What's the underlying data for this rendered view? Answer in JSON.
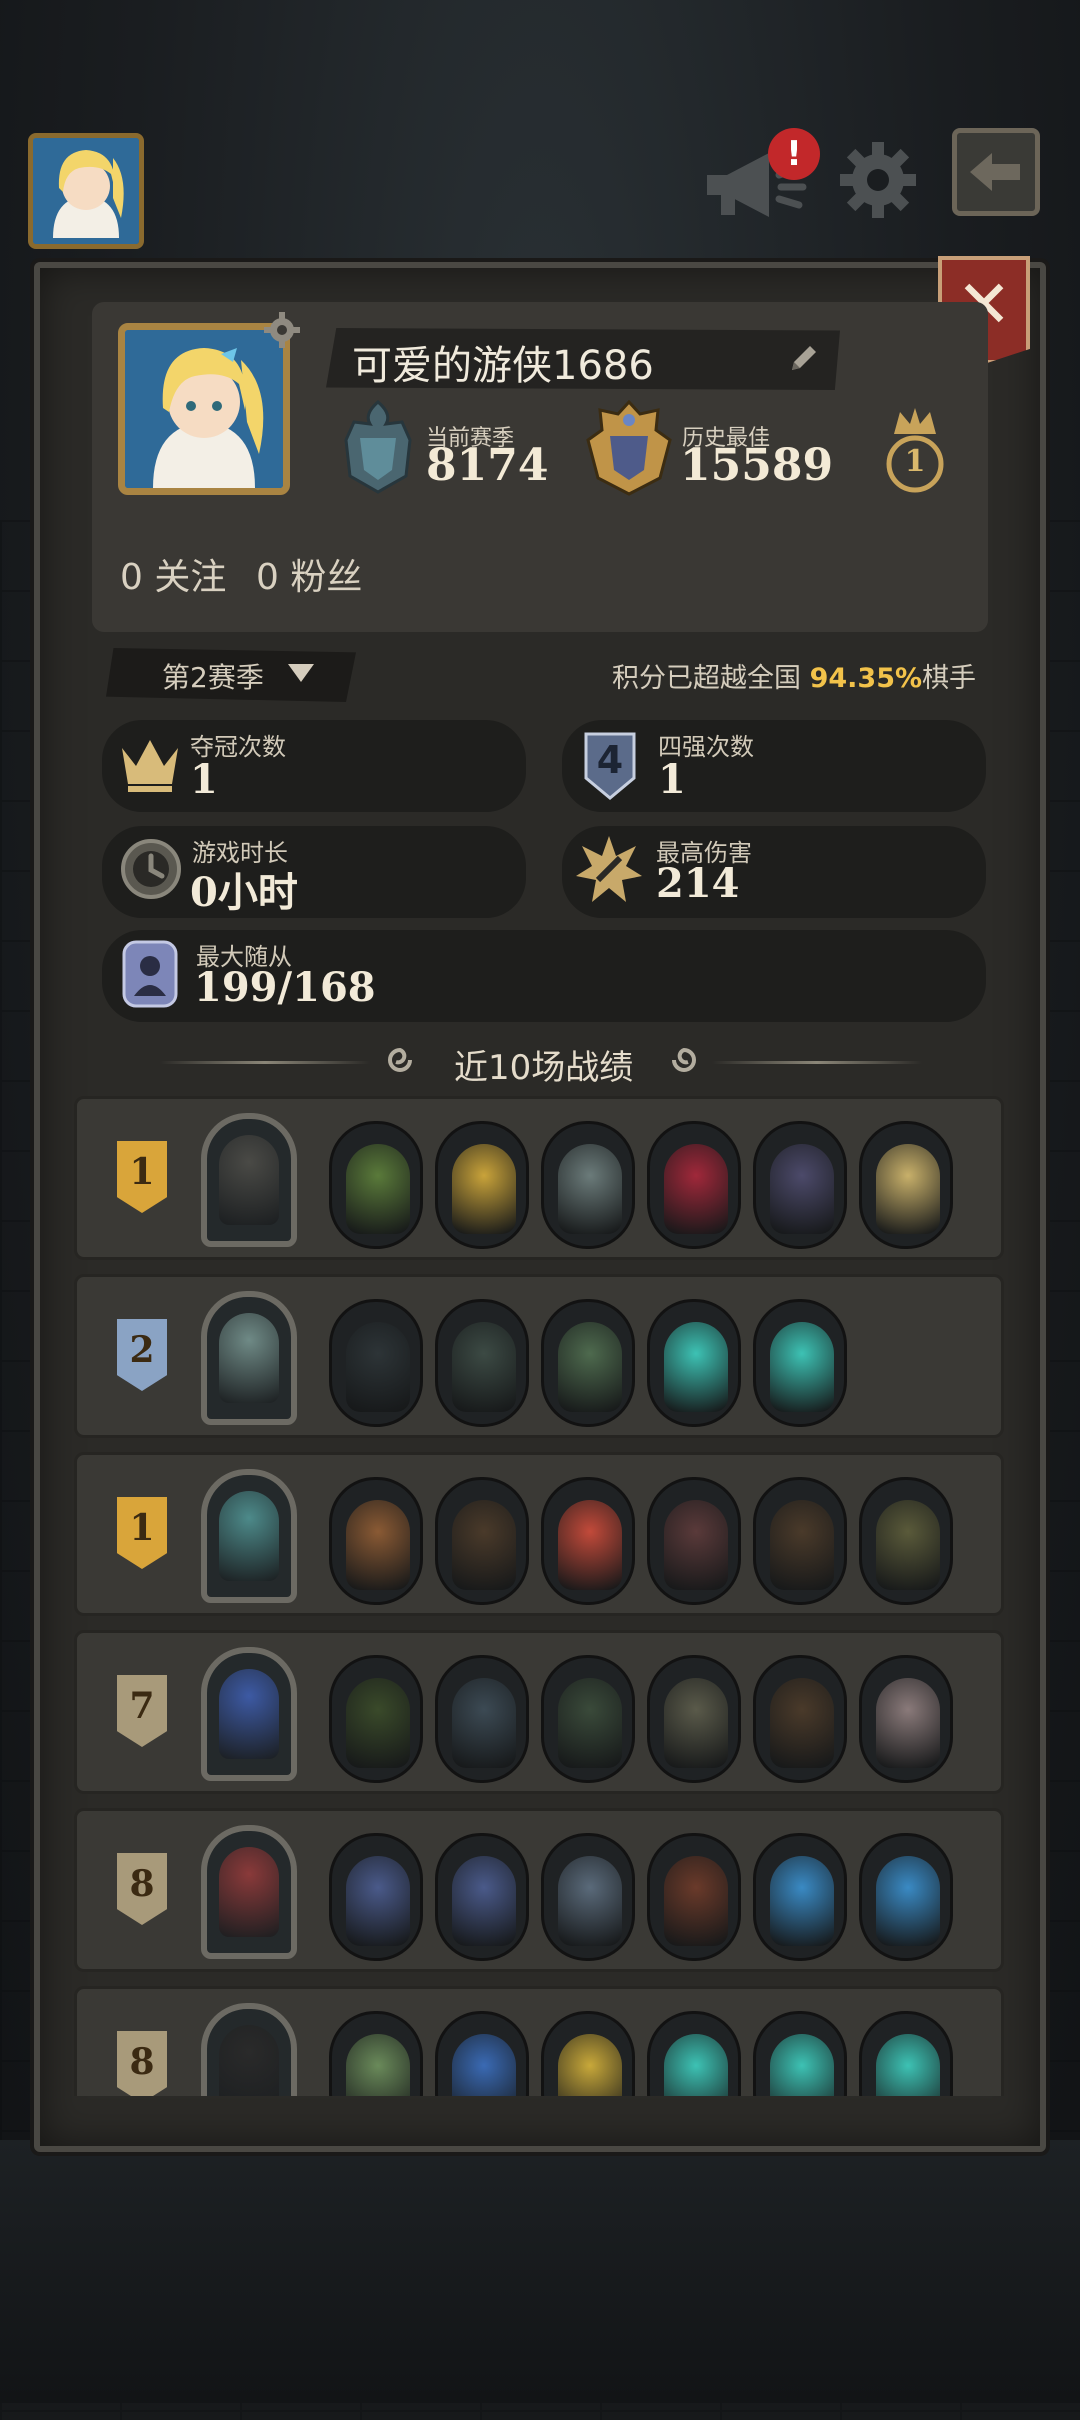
{
  "profile": {
    "name": "可爱的游侠1686",
    "current_season_label": "当前赛季",
    "current_season_score": "8174",
    "best_label": "历史最佳",
    "best_score": "15589",
    "crown_rank": "1",
    "following_count": "0",
    "following_label": "关注",
    "followers_count": "0",
    "followers_label": "粉丝"
  },
  "season": {
    "selected": "第2赛季",
    "surpass_prefix": "积分已超越全国",
    "surpass_percent": "94.35%",
    "surpass_suffix": "棋手"
  },
  "stats": {
    "championships_label": "夺冠次数",
    "championships_value": "1",
    "top4_label": "四强次数",
    "top4_value": "1",
    "top4_icon_text": "4",
    "playtime_label": "游戏时长",
    "playtime_value": "0小时",
    "max_damage_label": "最高伤害",
    "max_damage_value": "214",
    "max_minions_label": "最大随从",
    "max_minions_value": "199/168"
  },
  "recent": {
    "title": "近10场战绩",
    "matches": [
      {
        "place": "1",
        "badge_color": "#d9a53a",
        "hero_color": "#4a4a46",
        "units": [
          "#5a7a3a",
          "#c9a33a",
          "#6b7b7a",
          "#a0283a",
          "#4c4a6a",
          "#c8b06a"
        ]
      },
      {
        "place": "2",
        "badge_color": "#8aa3c4",
        "hero_color": "#6f8a86",
        "units": [
          "#2d3437",
          "#3c4a44",
          "#4e6a4e",
          "#3dc2b4",
          "#3dc2b4"
        ]
      },
      {
        "place": "1",
        "badge_color": "#d9a53a",
        "hero_color": "#4d8a8a",
        "units": [
          "#8a5a34",
          "#4a3a2a",
          "#c24a3a",
          "#5a3a3a",
          "#4a3a2a",
          "#5a5a3a"
        ]
      },
      {
        "place": "7",
        "badge_color": "#a89a7a",
        "hero_color": "#3d5aa4",
        "units": [
          "#3a4a2a",
          "#3c4a54",
          "#3a4a3a",
          "#5a5a4a",
          "#4a3a2a",
          "#8a7a7a"
        ]
      },
      {
        "place": "8",
        "badge_color": "#a89a7a",
        "hero_color": "#8a3a3a",
        "units": [
          "#4a5a8a",
          "#4a5a8a",
          "#5a6a7a",
          "#6a3a2a",
          "#3a8ac4",
          "#3a8ac4"
        ]
      },
      {
        "place": "8",
        "badge_color": "#a89a7a",
        "hero_color": "#2a2a2a",
        "units": [
          "#6a8a5a",
          "#3a6ab4",
          "#c8a83a",
          "#3dc2b4",
          "#3dc2b4",
          "#3dc2b4"
        ]
      }
    ]
  },
  "colors": {
    "panel": "#2b2a27",
    "gold": "#f2c24a",
    "close_button": "#8c2d26"
  },
  "icons": {
    "announcement": "megaphone-icon",
    "notification": "exclamation-icon",
    "settings": "gear-icon",
    "back": "back-arrow-icon",
    "close": "close-icon"
  }
}
